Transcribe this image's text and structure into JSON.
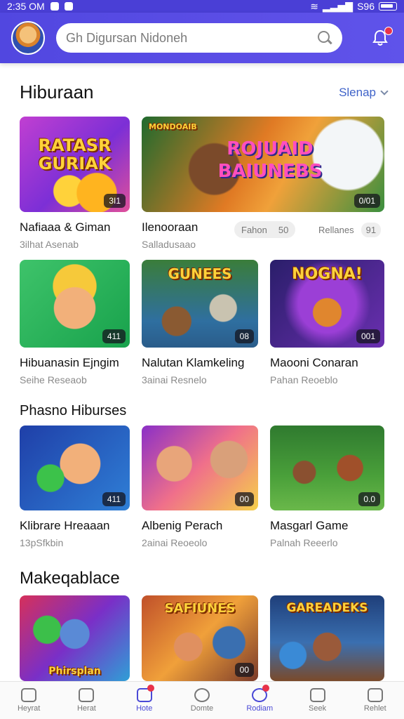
{
  "status": {
    "time": "2:35 OM",
    "battery": "S96"
  },
  "search": {
    "placeholder": "Gh Digursan Nidoneh"
  },
  "colors": {
    "brand": "#5147e0",
    "accent": "#3f63c9",
    "notify": "#e8324a"
  },
  "sections": [
    {
      "title": "Hiburaan",
      "see_all": "Slenap",
      "cards": [
        {
          "title": "Nafiaaa & Giman",
          "subtitle": "3ilhat Asenab",
          "badge": "3I1",
          "art": "RATASR GURIAK"
        },
        {
          "title": "Ilenooraan",
          "subtitle": "Salladusaao",
          "badge": "0/01",
          "art": "ROJUAID BAIUNEBS",
          "art_small": "MONDOAIB"
        },
        {
          "title": "Hibuanasin Ejngim",
          "subtitle": "Seihe Reseaob",
          "badge": "411"
        },
        {
          "title": "Nalutan Klamkeling",
          "subtitle": "3ainai Resnelo",
          "badge": "08",
          "art": "GUNEES"
        },
        {
          "title": "Maooni Conaran",
          "subtitle": "Pahan Reoeblo",
          "badge": "001",
          "art": "NOGNA!"
        }
      ],
      "chips": [
        {
          "label": "Fahon",
          "count": "50"
        },
        {
          "label": "Rellanes",
          "count": "91"
        }
      ]
    },
    {
      "title": "Phasno Hiburses",
      "cards": [
        {
          "title": "Klibrare Hreaaan",
          "subtitle": "13pSfkbin",
          "badge": "411"
        },
        {
          "title": "Albenig Perach",
          "subtitle": "2ainai Reoeolo",
          "badge": "00"
        },
        {
          "title": "Masgarl Game",
          "subtitle": "Palnah Reeerlo",
          "badge": "0.0"
        }
      ]
    },
    {
      "title": "Makeqablace",
      "cards": [
        {
          "title": "Phirsplan",
          "badge": ""
        },
        {
          "title": "",
          "badge": "00",
          "art": "SAFIUNES"
        },
        {
          "title": "",
          "badge": "",
          "art": "GAREADEKS"
        }
      ]
    }
  ],
  "nav": [
    {
      "label": "Heyrat",
      "icon": "home-icon"
    },
    {
      "label": "Herat",
      "icon": "inbox-icon"
    },
    {
      "label": "Hote",
      "icon": "library-icon",
      "active": true,
      "dot": true
    },
    {
      "label": "Domte",
      "icon": "location-icon"
    },
    {
      "label": "Rodiam",
      "icon": "profile-icon",
      "dot": true
    },
    {
      "label": "Seek",
      "icon": "chat-icon"
    },
    {
      "label": "Rehlet",
      "icon": "settings-icon"
    }
  ]
}
